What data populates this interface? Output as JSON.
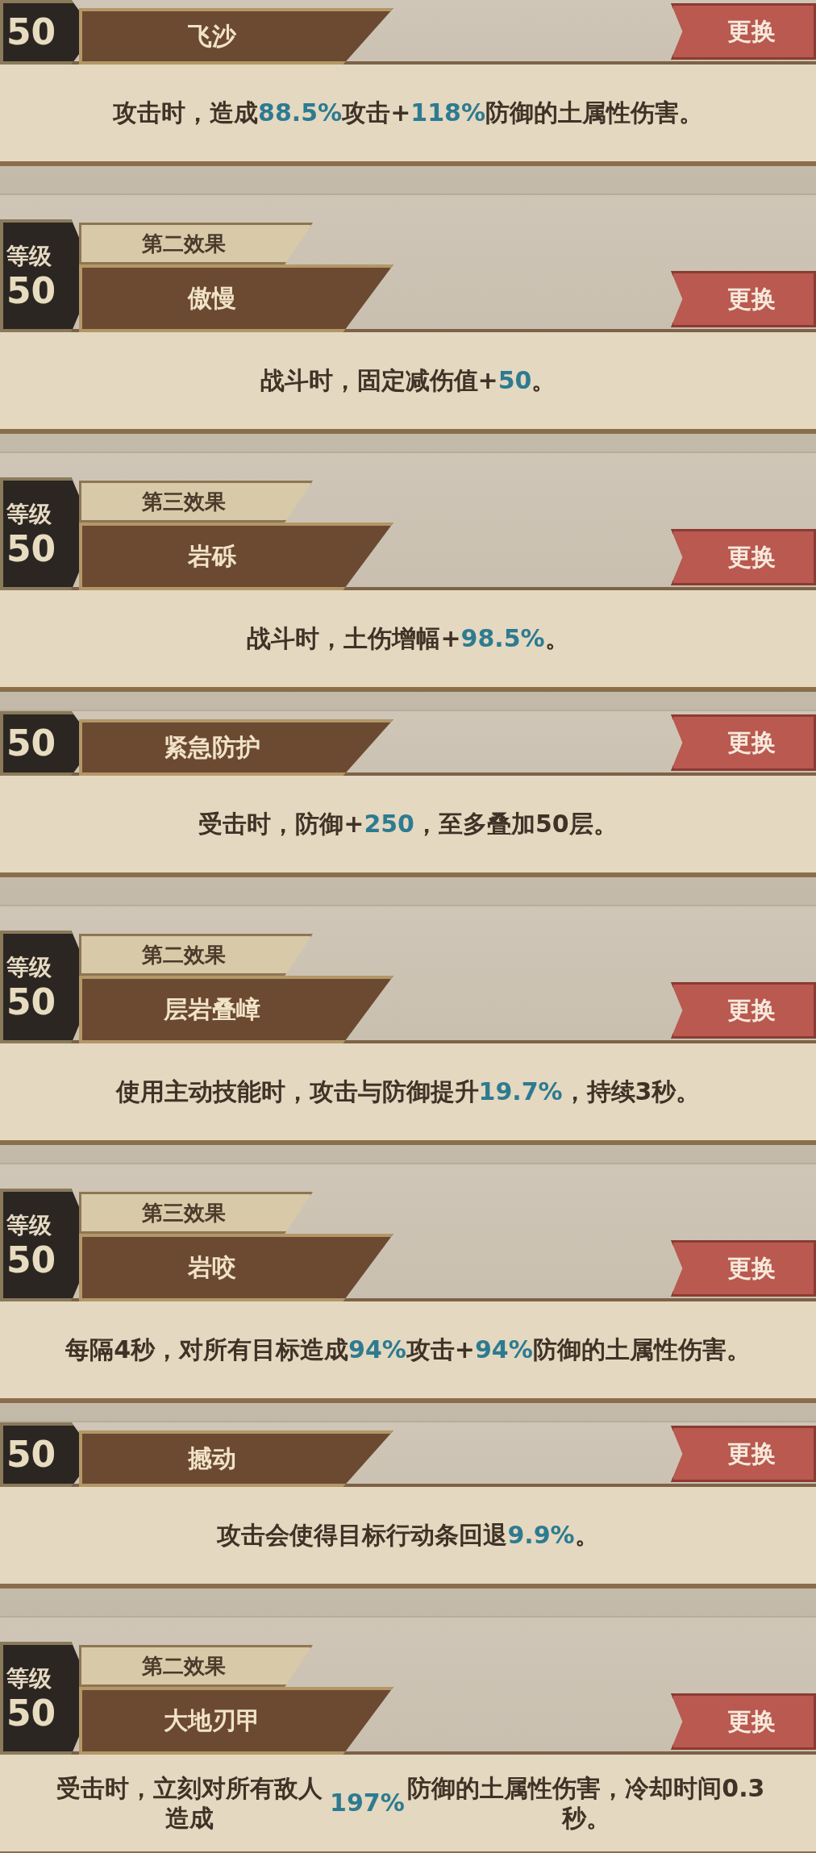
{
  "skills": [
    {
      "level": "50",
      "name": "飞沙",
      "button": "更换",
      "description": "攻击时，造成**88.5%**攻击+**118%**防御的土属性伤害。"
    },
    {
      "level_label": "等级",
      "level": "50",
      "effect": "第二效果",
      "name": "傲慢",
      "button": "更换",
      "description": "战斗时，固定减伤值+**50**。"
    },
    {
      "level_label": "等级",
      "level": "50",
      "effect": "第三效果",
      "name": "岩砾",
      "button": "更换",
      "description": "战斗时，土伤增幅+**98.5%**。"
    },
    {
      "level": "50",
      "name": "紧急防护",
      "button": "更换",
      "description": "受击时，防御+**250**，至多叠加50层。"
    },
    {
      "level_label": "等级",
      "level": "50",
      "effect": "第二效果",
      "name": "层岩叠嶂",
      "button": "更换",
      "description": "使用主动技能时，攻击与防御提升**19.7%**，持续3秒。"
    },
    {
      "level_label": "等级",
      "level": "50",
      "effect": "第三效果",
      "name": "岩咬",
      "button": "更换",
      "description": "每隔4秒，对所有目标造成**94%**攻击+**94%**防御的土属性伤害。"
    },
    {
      "level": "50",
      "name": "撼动",
      "button": "更换",
      "description": "攻击会使得目标行动条回退**9.9%**。"
    },
    {
      "level_label": "等级",
      "level": "50",
      "effect": "第二效果",
      "name": "大地刃甲",
      "button": "更换",
      "description": "受击时，立刻对所有敌人造成**197%**防御的土属性伤害，冷却时间0.3秒。"
    }
  ]
}
